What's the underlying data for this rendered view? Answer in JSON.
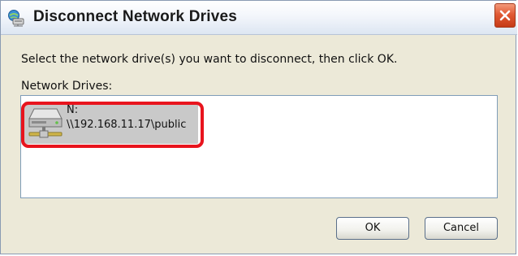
{
  "window": {
    "title": "Disconnect Network Drives",
    "title_icon": "network-drive-globe-icon",
    "close_icon": "close-icon",
    "close_color": "#d9532e"
  },
  "content": {
    "instructions": "Select the network drive(s) you want to disconnect, then click OK.",
    "list_label": "Network Drives:"
  },
  "drives": [
    {
      "letter": "N:",
      "path": "\\\\192.168.11.17\\public",
      "icon": "network-drive-icon",
      "selected": true
    }
  ],
  "highlight": {
    "color": "#e8141d",
    "target": "drive-item"
  },
  "buttons": {
    "ok_label": "OK",
    "cancel_label": "Cancel"
  }
}
